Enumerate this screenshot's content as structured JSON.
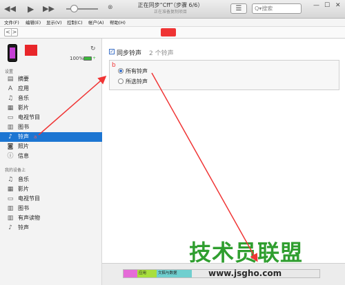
{
  "player": {
    "rewind_icon": "◀◀",
    "play_icon": "▶",
    "fast_forward_icon": "▶▶",
    "volume_level": 0.15,
    "cancel_icon": "⊗",
    "sync_title": "正在同步“Cff”（步骤 6/6）",
    "sync_subtitle": "正在准备复制项目",
    "list_icon": "☰",
    "search_placeholder": "Q▾搜索",
    "win_minimize": "—",
    "win_maximize": "☐",
    "win_close": "✕"
  },
  "menu": {
    "items": [
      "文件(F)",
      "编辑(E)",
      "显示(V)",
      "控制(C)",
      "帐户(A)",
      "帮助(H)"
    ]
  },
  "nav": {
    "back": "<",
    "forward": ">"
  },
  "device": {
    "battery_label": "100%",
    "battery_level": 1.0,
    "sync_icon": "↻"
  },
  "sidebar": {
    "settings_header": "设置",
    "settings_items": [
      {
        "icon": "▤",
        "label": "摘要"
      },
      {
        "icon": "A",
        "label": "应用"
      },
      {
        "icon": "♫",
        "label": "音乐"
      },
      {
        "icon": "▦",
        "label": "影片"
      },
      {
        "icon": "▭",
        "label": "电视节目"
      },
      {
        "icon": "▥",
        "label": "图书"
      },
      {
        "icon": "♪",
        "label": "铃声",
        "marker": "a"
      },
      {
        "icon": "◙",
        "label": "照片"
      },
      {
        "icon": "ⓘ",
        "label": "信息"
      }
    ],
    "ondevice_header": "我的设备上",
    "ondevice_items": [
      {
        "icon": "♫",
        "label": "音乐"
      },
      {
        "icon": "▦",
        "label": "影片"
      },
      {
        "icon": "▭",
        "label": "电视节目"
      },
      {
        "icon": "▥",
        "label": "图书"
      },
      {
        "icon": "▥",
        "label": "有声读物"
      },
      {
        "icon": "♪",
        "label": "铃声"
      }
    ]
  },
  "main": {
    "sync_label": "同步铃声",
    "tone_count": "2 个铃声",
    "marker_b": "b",
    "option_all": "所有铃声",
    "option_selected": "所选铃声"
  },
  "storage": {
    "segments": [
      {
        "label": "",
        "color": "#e56bd8",
        "fraction": 0.07
      },
      {
        "label": "应用",
        "color": "#a8df3d",
        "fraction": 0.1
      },
      {
        "label": "文稿与数据",
        "color": "#70cfcf",
        "fraction": 0.18
      }
    ]
  },
  "watermark": {
    "text": "技术员联盟",
    "url": "www.jsgho.com"
  },
  "colors": {
    "selection": "#1c75d2",
    "annotation_red": "#f03535",
    "watermark_green": "#2f9e2f"
  }
}
